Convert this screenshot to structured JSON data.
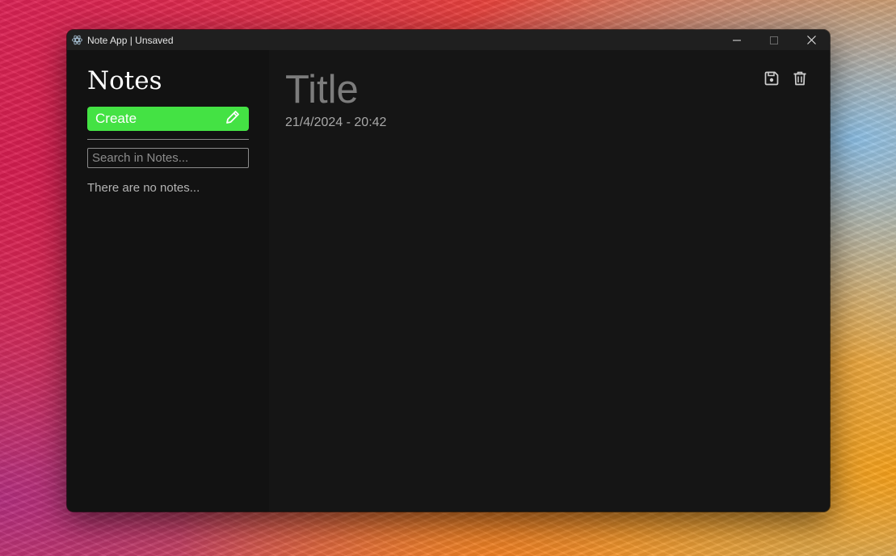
{
  "window": {
    "title": "Note App | Unsaved",
    "controls": [
      "minimize-icon",
      "maximize-icon",
      "close-icon"
    ]
  },
  "sidebar": {
    "heading": "Notes",
    "create_label": "Create",
    "create_icon": "pencil-icon",
    "search_placeholder": "Search in Notes...",
    "empty_message": "There are no notes..."
  },
  "editor": {
    "title": "Title",
    "date": "21/4/2024 - 20:42",
    "actions": [
      "save-icon",
      "trash-icon"
    ]
  },
  "colors": {
    "accent": "#44e244",
    "background": "#151515",
    "sidebar": "#121212"
  }
}
